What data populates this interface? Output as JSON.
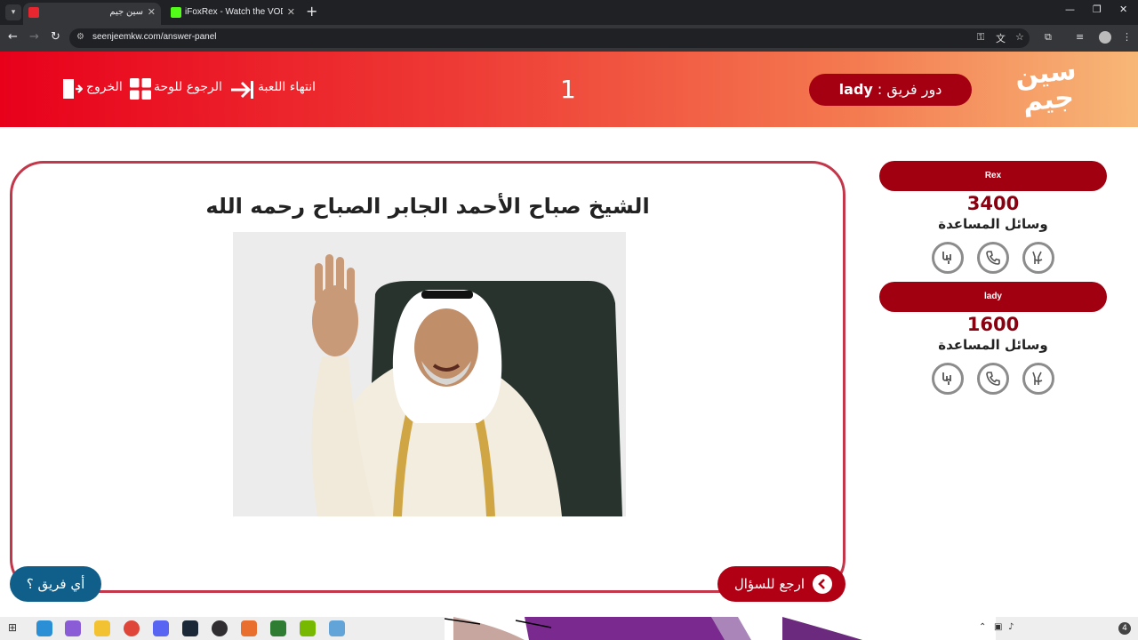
{
  "browser": {
    "tabs": [
      {
        "title": "سين جيم",
        "active": true
      },
      {
        "title": "iFoxRex - Watch the VOD on Ki",
        "active": false
      }
    ],
    "url": "seenjeemkw.com/answer-panel"
  },
  "header": {
    "logo_text": "سين جيم",
    "exit_label": "الخروج",
    "back_to_board_label": "الرجوع للوحة",
    "end_game_label": "انتهاء اللعبة",
    "round_number": "1",
    "turn_prefix": "دور فريق :",
    "turn_team": "lady"
  },
  "question": {
    "answer_text": "الشيخ صباح الأحمد الجابر الصباح رحمه الله",
    "back_to_question_label": "ارجع للسؤال",
    "which_team_label": "أي فريق ؟"
  },
  "teams": [
    {
      "name": "Rex",
      "score": "3400",
      "aids_label": "وسائل المساعدة",
      "aids": [
        "double-points-icon",
        "phone-icon",
        "swap-icon"
      ]
    },
    {
      "name": "lady",
      "score": "1600",
      "aids_label": "وسائل المساعدة",
      "aids": [
        "double-points-icon",
        "phone-icon",
        "swap-icon"
      ]
    }
  ],
  "taskbar": {
    "notification_count": "4"
  },
  "colors": {
    "accent_red": "#a00010",
    "card_border": "#c2374a",
    "which_team_blue": "#0f5f8a"
  }
}
